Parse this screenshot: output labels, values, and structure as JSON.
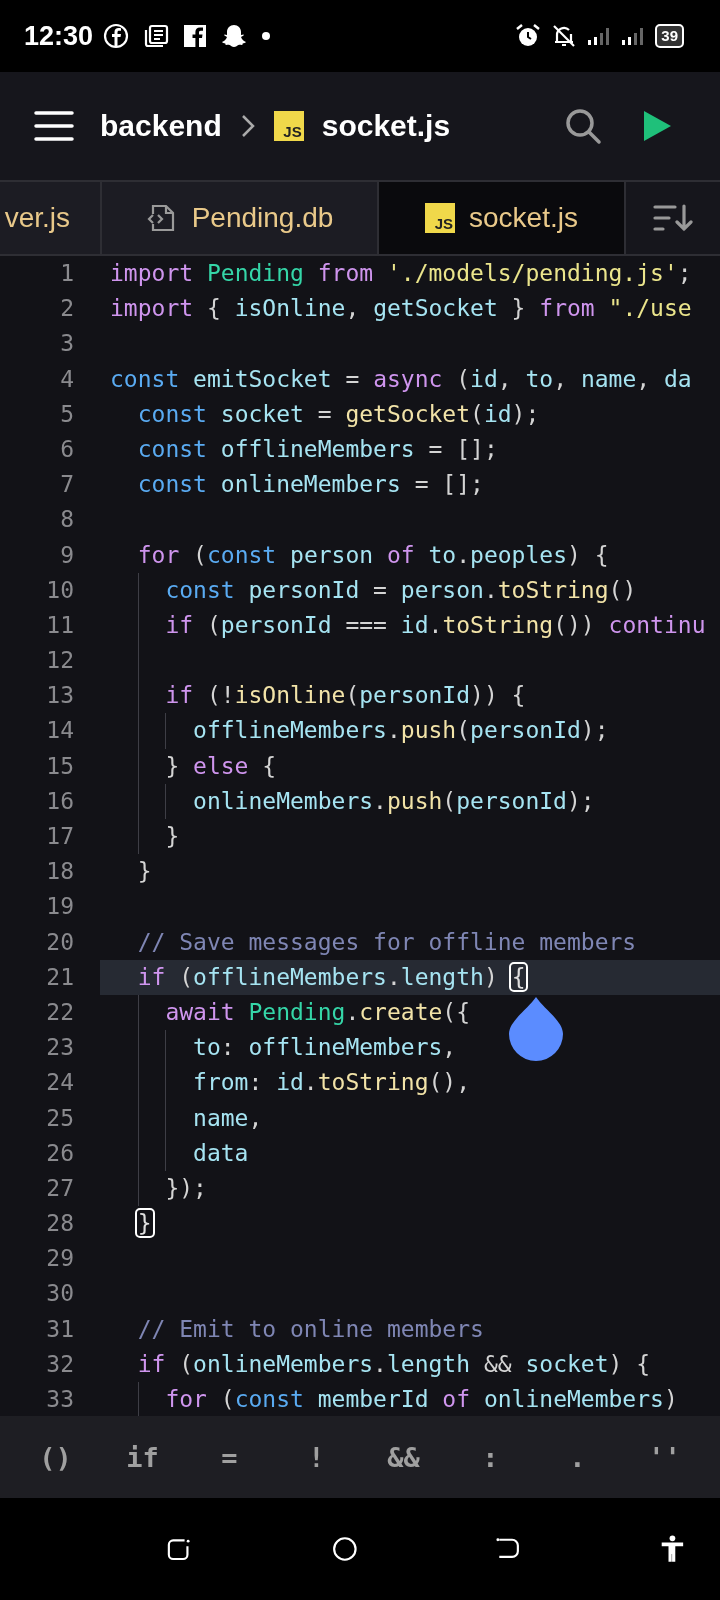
{
  "status_bar": {
    "time": "12:30",
    "battery": "39"
  },
  "header": {
    "breadcrumb": [
      {
        "label": "backend"
      },
      {
        "label": "socket.js",
        "badge": "JS"
      }
    ]
  },
  "tabs": [
    {
      "label": "ver.js",
      "selected": false
    },
    {
      "label": "Pending.db",
      "selected": false
    },
    {
      "label": "socket.js",
      "badge": "JS",
      "selected": true
    }
  ],
  "editor": {
    "cursor_handle": true,
    "lines": [
      {
        "n": "1",
        "current": false,
        "tokens": [
          {
            "kind": "kw",
            "text": "import"
          },
          {
            "kind": "cl",
            "text": " Pending"
          },
          {
            "kind": "kw",
            "text": " from"
          },
          {
            "kind": "s",
            "text": " './models/pending.js'"
          },
          {
            "kind": "p",
            "text": ";"
          }
        ]
      },
      {
        "n": "2",
        "current": false,
        "tokens": [
          {
            "kind": "kw",
            "text": "import"
          },
          {
            "kind": "p",
            "text": " { "
          },
          {
            "kind": "id",
            "text": "isOnline"
          },
          {
            "kind": "p",
            "text": ", "
          },
          {
            "kind": "id",
            "text": "getSocket"
          },
          {
            "kind": "p",
            "text": " } "
          },
          {
            "kind": "kw",
            "text": "from"
          },
          {
            "kind": "s",
            "text": " \"./use"
          }
        ]
      },
      {
        "n": "3",
        "current": false
      },
      {
        "n": "4",
        "current": false,
        "tokens": [
          {
            "kind": "st",
            "text": "const"
          },
          {
            "kind": "id",
            "text": " emitSocket"
          },
          {
            "kind": "p",
            "text": " = "
          },
          {
            "kind": "kw",
            "text": "async"
          },
          {
            "kind": "p",
            "text": " ("
          },
          {
            "kind": "id",
            "text": "id"
          },
          {
            "kind": "p",
            "text": ", "
          },
          {
            "kind": "id",
            "text": "to"
          },
          {
            "kind": "p",
            "text": ", "
          },
          {
            "kind": "id",
            "text": "name"
          },
          {
            "kind": "p",
            "text": ", "
          },
          {
            "kind": "id",
            "text": "da"
          }
        ],
        "children": [
          {
            "n": "5",
            "current": false,
            "tokens": [
              {
                "kind": "st",
                "text": "const"
              },
              {
                "kind": "id",
                "text": " socket"
              },
              {
                "kind": "p",
                "text": " = "
              },
              {
                "kind": "fn",
                "text": "getSocket"
              },
              {
                "kind": "p",
                "text": "("
              },
              {
                "kind": "id",
                "text": "id"
              },
              {
                "kind": "p",
                "text": ");"
              }
            ]
          },
          {
            "n": "6",
            "current": false,
            "tokens": [
              {
                "kind": "st",
                "text": "const"
              },
              {
                "kind": "id",
                "text": " offlineMembers"
              },
              {
                "kind": "p",
                "text": " = [];"
              }
            ]
          },
          {
            "n": "7",
            "current": false,
            "tokens": [
              {
                "kind": "st",
                "text": "const"
              },
              {
                "kind": "id",
                "text": " onlineMembers"
              },
              {
                "kind": "p",
                "text": " = [];"
              }
            ]
          },
          {
            "n": "8",
            "current": false
          },
          {
            "n": "9",
            "current": false,
            "tokens": [
              {
                "kind": "kw",
                "text": "for"
              },
              {
                "kind": "p",
                "text": " ("
              },
              {
                "kind": "st",
                "text": "const"
              },
              {
                "kind": "id",
                "text": " person"
              },
              {
                "kind": "kw",
                "text": " of"
              },
              {
                "kind": "id",
                "text": " to"
              },
              {
                "kind": "p",
                "text": "."
              },
              {
                "kind": "id",
                "text": "peoples"
              },
              {
                "kind": "p",
                "text": ") {"
              }
            ],
            "children": [
              {
                "n": "10",
                "current": false,
                "tokens": [
                  {
                    "kind": "st",
                    "text": "const"
                  },
                  {
                    "kind": "id",
                    "text": " personId"
                  },
                  {
                    "kind": "p",
                    "text": " = "
                  },
                  {
                    "kind": "id",
                    "text": "person"
                  },
                  {
                    "kind": "p",
                    "text": "."
                  },
                  {
                    "kind": "fn",
                    "text": "toString"
                  },
                  {
                    "kind": "p",
                    "text": "()"
                  }
                ]
              },
              {
                "n": "11",
                "current": false,
                "tokens": [
                  {
                    "kind": "kw",
                    "text": "if"
                  },
                  {
                    "kind": "p",
                    "text": " ("
                  },
                  {
                    "kind": "id",
                    "text": "personId"
                  },
                  {
                    "kind": "p",
                    "text": " === "
                  },
                  {
                    "kind": "id",
                    "text": "id"
                  },
                  {
                    "kind": "p",
                    "text": "."
                  },
                  {
                    "kind": "fn",
                    "text": "toString"
                  },
                  {
                    "kind": "p",
                    "text": "()) "
                  },
                  {
                    "kind": "kw",
                    "text": "continu"
                  }
                ]
              },
              {
                "n": "12",
                "current": false
              },
              {
                "n": "13",
                "current": false,
                "tokens": [
                  {
                    "kind": "kw",
                    "text": "if"
                  },
                  {
                    "kind": "p",
                    "text": " (!"
                  },
                  {
                    "kind": "fn",
                    "text": "isOnline"
                  },
                  {
                    "kind": "p",
                    "text": "("
                  },
                  {
                    "kind": "id",
                    "text": "personId"
                  },
                  {
                    "kind": "p",
                    "text": ")) {"
                  }
                ],
                "children": [
                  {
                    "n": "14",
                    "current": false,
                    "tokens": [
                      {
                        "kind": "id",
                        "text": "offlineMembers"
                      },
                      {
                        "kind": "p",
                        "text": "."
                      },
                      {
                        "kind": "fn",
                        "text": "push"
                      },
                      {
                        "kind": "p",
                        "text": "("
                      },
                      {
                        "kind": "id",
                        "text": "personId"
                      },
                      {
                        "kind": "p",
                        "text": ");"
                      }
                    ]
                  }
                ]
              },
              {
                "n": "15",
                "current": false,
                "tokens": [
                  {
                    "kind": "p",
                    "text": "} "
                  },
                  {
                    "kind": "kw",
                    "text": "else"
                  },
                  {
                    "kind": "p",
                    "text": " {"
                  }
                ],
                "children": [
                  {
                    "n": "16",
                    "current": false,
                    "tokens": [
                      {
                        "kind": "id",
                        "text": "onlineMembers"
                      },
                      {
                        "kind": "p",
                        "text": "."
                      },
                      {
                        "kind": "fn",
                        "text": "push"
                      },
                      {
                        "kind": "p",
                        "text": "("
                      },
                      {
                        "kind": "id",
                        "text": "personId"
                      },
                      {
                        "kind": "p",
                        "text": ");"
                      }
                    ]
                  }
                ]
              },
              {
                "n": "17",
                "current": false,
                "tokens": [
                  {
                    "kind": "p",
                    "text": "}"
                  }
                ]
              }
            ]
          },
          {
            "n": "18",
            "current": false,
            "tokens": [
              {
                "kind": "p",
                "text": "}"
              }
            ]
          },
          {
            "n": "19",
            "current": false
          },
          {
            "n": "20",
            "current": false,
            "tokens": [
              {
                "kind": "c",
                "text": "// Save messages for offline members"
              }
            ]
          },
          {
            "n": "21",
            "current": true,
            "tokens": [
              {
                "kind": "kw",
                "text": "if"
              },
              {
                "kind": "p",
                "text": " ("
              },
              {
                "kind": "id",
                "text": "offlineMembers"
              },
              {
                "kind": "p",
                "text": "."
              },
              {
                "kind": "id",
                "text": "length"
              },
              {
                "kind": "p",
                "text": ") "
              },
              {
                "kind": "m",
                "text": "{"
              }
            ],
            "children": [
              {
                "n": "22",
                "current": false,
                "tokens": [
                  {
                    "kind": "kw",
                    "text": "await"
                  },
                  {
                    "kind": "cl",
                    "text": " Pending"
                  },
                  {
                    "kind": "p",
                    "text": "."
                  },
                  {
                    "kind": "fn",
                    "text": "create"
                  },
                  {
                    "kind": "p",
                    "text": "({"
                  }
                ],
                "children": [
                  {
                    "n": "23",
                    "current": false,
                    "tokens": [
                      {
                        "kind": "id",
                        "text": "to"
                      },
                      {
                        "kind": "p",
                        "text": ": "
                      },
                      {
                        "kind": "id",
                        "text": "offlineMembers"
                      },
                      {
                        "kind": "p",
                        "text": ","
                      }
                    ]
                  },
                  {
                    "n": "24",
                    "current": false,
                    "tokens": [
                      {
                        "kind": "id",
                        "text": "from"
                      },
                      {
                        "kind": "p",
                        "text": ": "
                      },
                      {
                        "kind": "id",
                        "text": "id"
                      },
                      {
                        "kind": "p",
                        "text": "."
                      },
                      {
                        "kind": "fn",
                        "text": "toString"
                      },
                      {
                        "kind": "p",
                        "text": "(),"
                      }
                    ]
                  },
                  {
                    "n": "25",
                    "current": false,
                    "tokens": [
                      {
                        "kind": "id",
                        "text": "name"
                      },
                      {
                        "kind": "p",
                        "text": ","
                      }
                    ]
                  },
                  {
                    "n": "26",
                    "current": false,
                    "tokens": [
                      {
                        "kind": "id",
                        "text": "data"
                      }
                    ]
                  }
                ]
              },
              {
                "n": "27",
                "current": false,
                "tokens": [
                  {
                    "kind": "p",
                    "text": "});"
                  }
                ]
              }
            ]
          },
          {
            "n": "28",
            "current": false,
            "tokens": [
              {
                "kind": "m",
                "text": "}"
              }
            ]
          },
          {
            "n": "29",
            "current": false
          },
          {
            "n": "30",
            "current": false
          },
          {
            "n": "31",
            "current": false,
            "tokens": [
              {
                "kind": "c",
                "text": "// Emit to online members"
              }
            ]
          },
          {
            "n": "32",
            "current": false,
            "tokens": [
              {
                "kind": "kw",
                "text": "if"
              },
              {
                "kind": "p",
                "text": " ("
              },
              {
                "kind": "id",
                "text": "onlineMembers"
              },
              {
                "kind": "p",
                "text": "."
              },
              {
                "kind": "id",
                "text": "length"
              },
              {
                "kind": "p",
                "text": " && "
              },
              {
                "kind": "id",
                "text": "socket"
              },
              {
                "kind": "p",
                "text": ") {"
              }
            ],
            "children": [
              {
                "n": "33",
                "current": false,
                "tokens": [
                  {
                    "kind": "kw",
                    "text": "for"
                  },
                  {
                    "kind": "p",
                    "text": " ("
                  },
                  {
                    "kind": "st",
                    "text": "const"
                  },
                  {
                    "kind": "id",
                    "text": " memberId"
                  },
                  {
                    "kind": "kw",
                    "text": " of"
                  },
                  {
                    "kind": "id",
                    "text": " onlineMembers"
                  },
                  {
                    "kind": "p",
                    "text": ")"
                  }
                ]
              }
            ]
          }
        ]
      }
    ]
  },
  "shortcut_keys": [
    "()",
    "if",
    "=",
    "!",
    "&&",
    ":",
    ".",
    "''"
  ]
}
